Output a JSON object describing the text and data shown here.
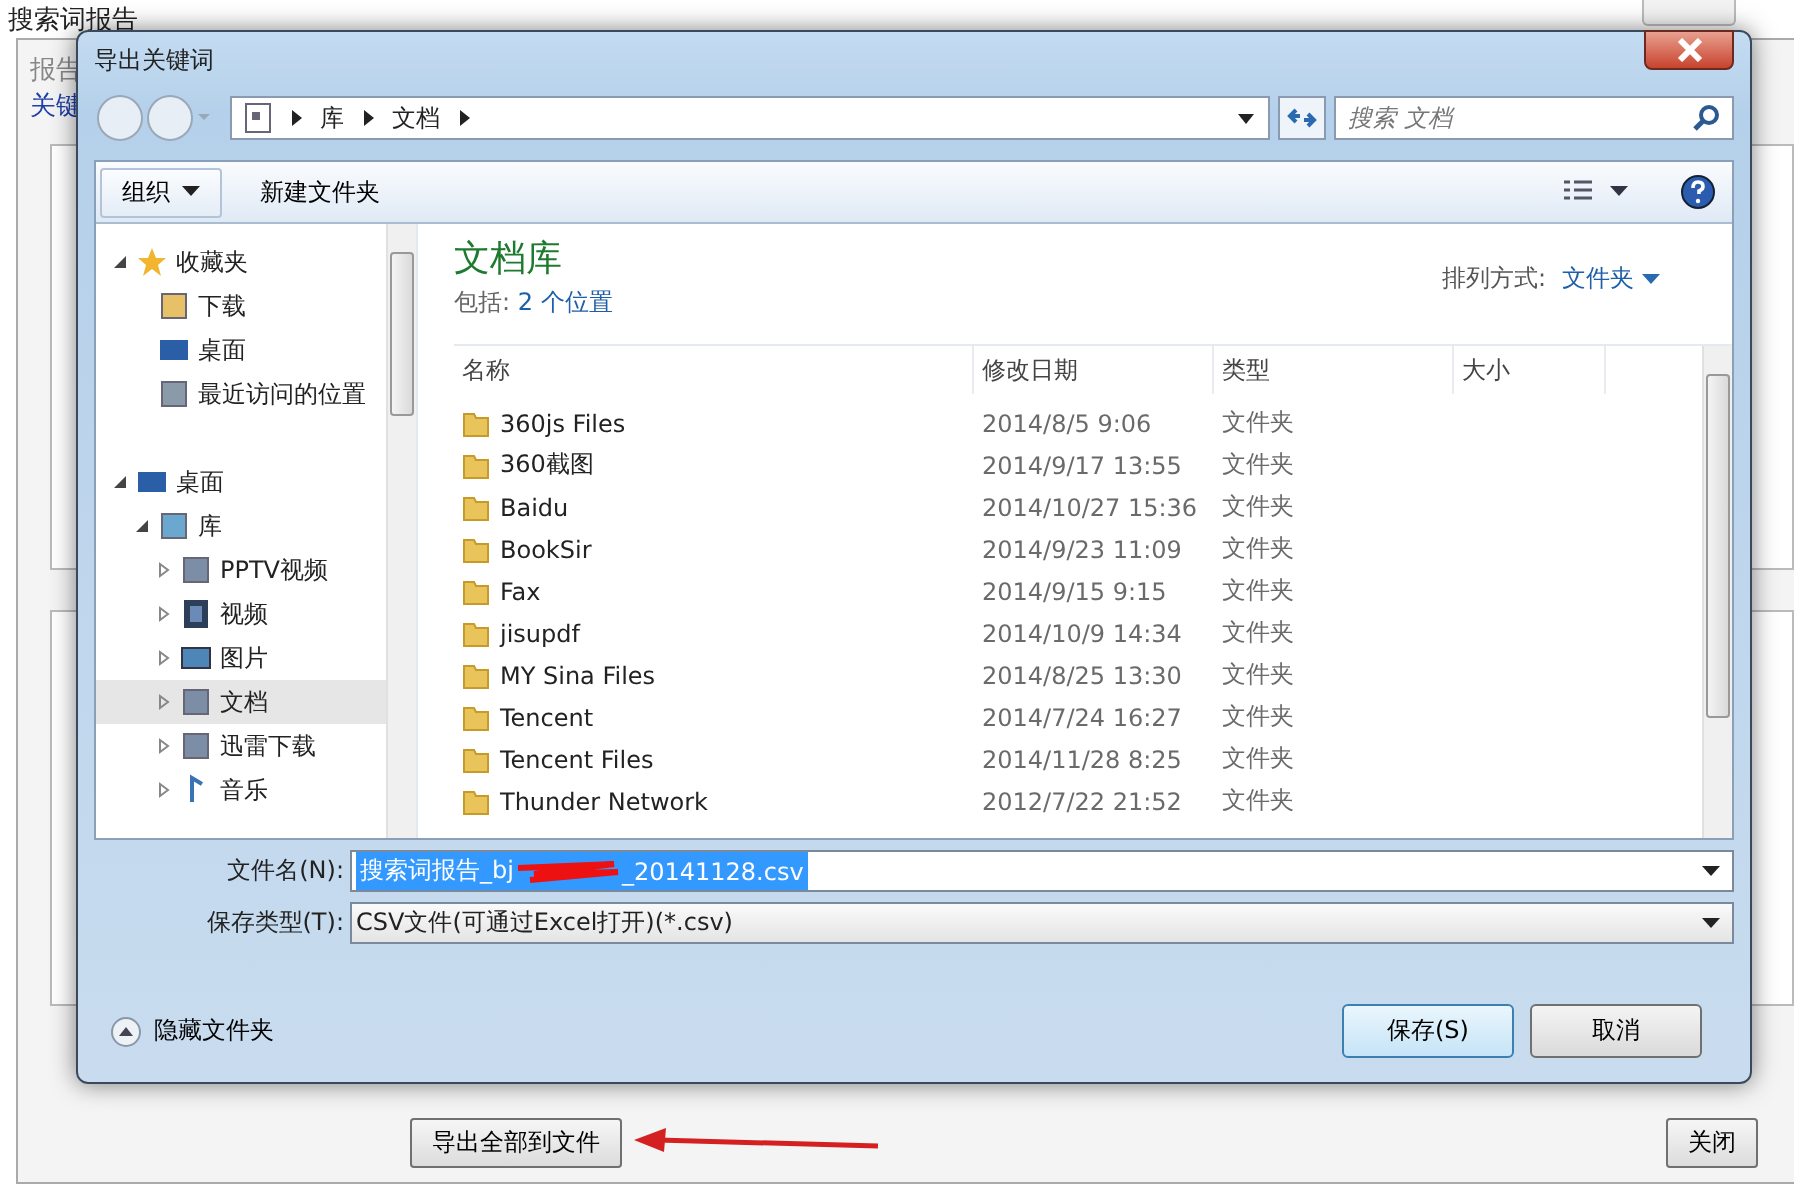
{
  "background_window": {
    "title": "搜索词报告",
    "tab_label": "报告",
    "link": "关键",
    "export_button": "导出全部到文件",
    "close_button": "关闭"
  },
  "dialog": {
    "title": "导出关键词",
    "address": {
      "crumbs": [
        "库",
        "文档"
      ],
      "search_placeholder": "搜索 文档"
    },
    "toolbar": {
      "organize": "组织",
      "new_folder": "新建文件夹"
    },
    "nav": [
      {
        "label": "收藏夹",
        "kind": "favorites",
        "expanded": true,
        "selected": false,
        "children": [
          {
            "label": "下载",
            "kind": "downloads",
            "selected": false
          },
          {
            "label": "桌面",
            "kind": "desktop",
            "selected": false
          },
          {
            "label": "最近访问的位置",
            "kind": "recent",
            "selected": false
          }
        ]
      },
      {
        "label": "桌面",
        "kind": "desktop",
        "expanded": true,
        "selected": false,
        "children": [
          {
            "label": "库",
            "kind": "library",
            "expanded": true,
            "selected": false,
            "children": [
              {
                "label": "PPTV视频",
                "kind": "document",
                "expanded": false,
                "selected": false
              },
              {
                "label": "视频",
                "kind": "video",
                "expanded": false,
                "selected": false
              },
              {
                "label": "图片",
                "kind": "picture",
                "expanded": false,
                "selected": false
              },
              {
                "label": "文档",
                "kind": "document",
                "expanded": false,
                "selected": true
              },
              {
                "label": "迅雷下载",
                "kind": "document",
                "expanded": false,
                "selected": false
              },
              {
                "label": "音乐",
                "kind": "music",
                "expanded": false,
                "selected": false
              }
            ]
          }
        ]
      }
    ],
    "library": {
      "title": "文档库",
      "includes_label": "包括:",
      "includes_link": "2 个位置",
      "arrange_label": "排列方式:",
      "arrange_value": "文件夹"
    },
    "columns": [
      "名称",
      "修改日期",
      "类型",
      "大小"
    ],
    "rows": [
      {
        "name": "360js Files",
        "modified": "2014/8/5 9:06",
        "type": "文件夹"
      },
      {
        "name": "360截图",
        "modified": "2014/9/17 13:55",
        "type": "文件夹"
      },
      {
        "name": "Baidu",
        "modified": "2014/10/27 15:36",
        "type": "文件夹"
      },
      {
        "name": "BookSir",
        "modified": "2014/9/23 11:09",
        "type": "文件夹"
      },
      {
        "name": "Fax",
        "modified": "2014/9/15 9:15",
        "type": "文件夹"
      },
      {
        "name": "jisupdf",
        "modified": "2014/10/9 14:34",
        "type": "文件夹"
      },
      {
        "name": "MY Sina Files",
        "modified": "2014/8/25 13:30",
        "type": "文件夹"
      },
      {
        "name": "Tencent",
        "modified": "2014/7/24 16:27",
        "type": "文件夹"
      },
      {
        "name": "Tencent Files",
        "modified": "2014/11/28 8:25",
        "type": "文件夹"
      },
      {
        "name": "Thunder Network",
        "modified": "2012/7/22 21:52",
        "type": "文件夹"
      }
    ],
    "file_name": {
      "label": "文件名(N):",
      "value_before": "搜索词报告_bj",
      "value_after": "_20141128.csv",
      "selected": true
    },
    "save_type": {
      "label": "保存类型(T):",
      "value": "CSV文件(可通过Excel打开)(*.csv)"
    },
    "hide_folders": "隐藏文件夹",
    "save_button": "保存(S)",
    "cancel_button": "取消"
  }
}
